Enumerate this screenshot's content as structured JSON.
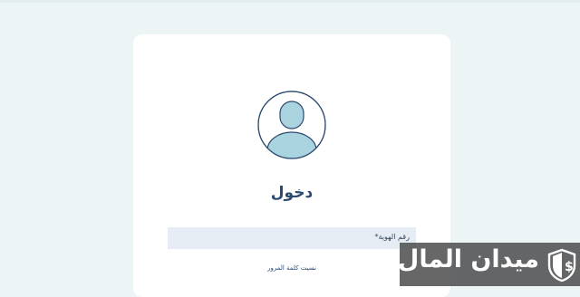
{
  "login": {
    "title": "دخول",
    "id_field": {
      "label": "رقم الهوية",
      "required_mark": "*",
      "value": ""
    },
    "forgot_password": "نسيت كلمة المرور"
  },
  "watermark": {
    "text": "ميدان المال",
    "logo_icon": "shield-dollar-icon"
  },
  "colors": {
    "background": "#edf4f6",
    "card": "#ffffff",
    "avatar_fill": "#a9d3df",
    "avatar_stroke": "#2c4a6e",
    "title": "#2c4a6e",
    "field": "#e6ecf4"
  }
}
